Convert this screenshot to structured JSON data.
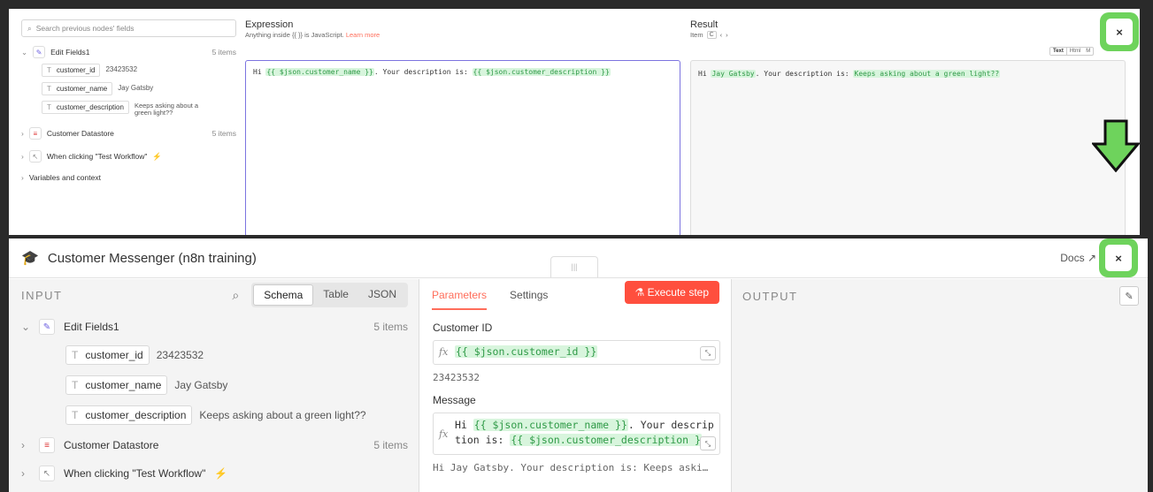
{
  "top": {
    "search_placeholder": "Search previous nodes' fields",
    "tree": {
      "edit_fields": {
        "label": "Edit Fields1",
        "count": "5 items"
      },
      "fields": [
        {
          "type": "T",
          "name": "customer_id",
          "value": "23423532"
        },
        {
          "type": "T",
          "name": "customer_name",
          "value": "Jay Gatsby"
        },
        {
          "type": "T",
          "name": "customer_description",
          "value": "Keeps asking about a green light??"
        }
      ],
      "datastore": {
        "label": "Customer Datastore",
        "count": "5 items"
      },
      "trigger": {
        "label": "When clicking \"Test Workflow\""
      },
      "variables": {
        "label": "Variables and context"
      }
    },
    "expression": {
      "title": "Expression",
      "subtitle": "Anything inside {{ }} is JavaScript.",
      "learn_more": "Learn more",
      "text_1": "Hi ",
      "expr_1": "{{ $json.customer_name }}",
      "text_2": ". Your description is: ",
      "expr_2": "{{ $json.customer_description }}"
    },
    "result": {
      "title": "Result",
      "item_label": "Item",
      "item_index": "C",
      "prev": "‹",
      "next": "›",
      "tabs": [
        "Text",
        "Html",
        "M"
      ],
      "text_1": "Hi ",
      "val_1": "Jay Gatsby",
      "text_2": ". Your description is: ",
      "val_2": "Keeps asking about a green light??"
    },
    "close": "×"
  },
  "bottom": {
    "node_title": "Customer Messenger (n8n training)",
    "handle": "|||",
    "docs": "Docs",
    "close": "×",
    "input": {
      "heading": "INPUT",
      "view_tabs": [
        "Schema",
        "Table",
        "JSON"
      ],
      "edit_fields": {
        "label": "Edit Fields1",
        "count": "5 items"
      },
      "fields": [
        {
          "type": "T",
          "name": "customer_id",
          "value": "23423532"
        },
        {
          "type": "T",
          "name": "customer_name",
          "value": "Jay Gatsby"
        },
        {
          "type": "T",
          "name": "customer_description",
          "value": "Keeps asking about a green light??"
        }
      ],
      "datastore": {
        "label": "Customer Datastore",
        "count": "5 items"
      },
      "trigger": {
        "label": "When clicking \"Test Workflow\""
      }
    },
    "params": {
      "tab_parameters": "Parameters",
      "tab_settings": "Settings",
      "execute": "Execute step",
      "customer_id_label": "Customer ID",
      "customer_id_expr": "{{ $json.customer_id }}",
      "customer_id_result": "23423532",
      "message_label": "Message",
      "message_line1_text": "Hi ",
      "message_line1_expr": "{{ $json.customer_name }}",
      "message_line1_tail": ". Your descrip",
      "message_line2_text": "tion is: ",
      "message_line2_expr": "{{ $json.customer_description }",
      "message_result": "Hi Jay Gatsby. Your description is: Keeps aski…"
    },
    "output": {
      "heading": "OUTPUT"
    }
  },
  "colors": {
    "accent": "#ff6d5a",
    "highlight_bg": "#d8f5dd",
    "highlight_fg": "#2f9a47",
    "annotation_green": "#6ed35c"
  }
}
